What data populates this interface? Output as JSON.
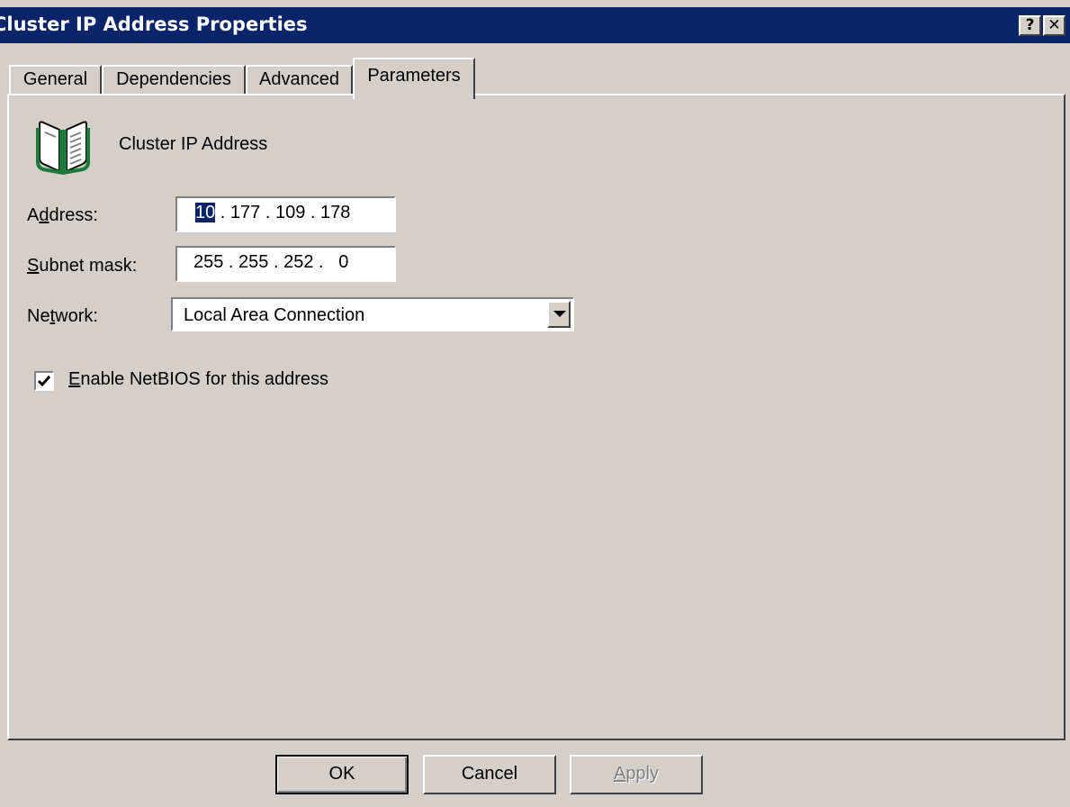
{
  "window": {
    "title": "Cluster IP Address Properties",
    "help_glyph": "?",
    "close_glyph": "✕"
  },
  "tabs": [
    {
      "label": "General",
      "active": false
    },
    {
      "label": "Dependencies",
      "active": false
    },
    {
      "label": "Advanced",
      "active": false
    },
    {
      "label": "Parameters",
      "active": true
    }
  ],
  "resource": {
    "icon": "open-book-icon",
    "name": "Cluster IP Address"
  },
  "fields": {
    "address": {
      "label_pre": "A",
      "label_key": "d",
      "label_post": "dress:",
      "octets": [
        "10",
        "177",
        "109",
        "178"
      ]
    },
    "subnet": {
      "label_pre": "",
      "label_key": "S",
      "label_post": "ubnet mask:",
      "octets": [
        "255",
        "255",
        "252",
        "0"
      ]
    },
    "network": {
      "label_pre": "Ne",
      "label_key": "t",
      "label_post": "work:",
      "value": "Local Area Connection"
    }
  },
  "netbios": {
    "checked": true,
    "label_key": "E",
    "label_post": "nable NetBIOS for this address"
  },
  "buttons": {
    "ok": "OK",
    "cancel": "Cancel",
    "apply_key": "A",
    "apply_post": "pply"
  },
  "colors": {
    "titlebar": "#0a246a",
    "face": "#d4d0c8",
    "selection": "#0a246a"
  }
}
